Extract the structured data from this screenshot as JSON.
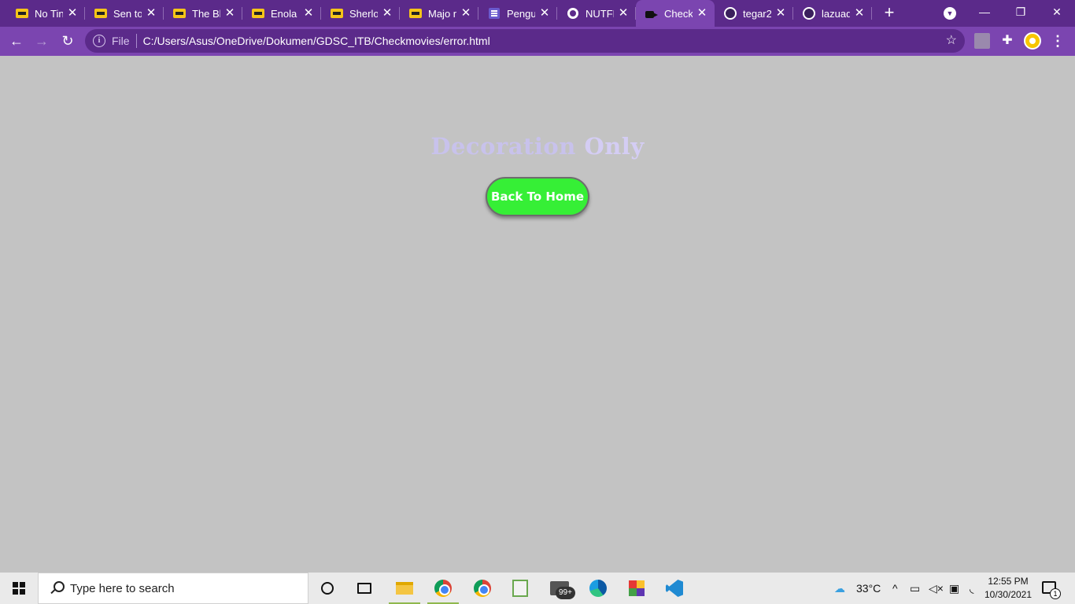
{
  "browser": {
    "tabs": [
      {
        "title": "No Tin",
        "icon": "imdb-icon"
      },
      {
        "title": "Sen to",
        "icon": "imdb-icon"
      },
      {
        "title": "The Bl",
        "icon": "imdb-icon"
      },
      {
        "title": "Enola H",
        "icon": "imdb-icon"
      },
      {
        "title": "Sherlo",
        "icon": "imdb-icon"
      },
      {
        "title": "Majo n",
        "icon": "imdb-icon"
      },
      {
        "title": "Pengu",
        "icon": "list-icon"
      },
      {
        "title": "NUTFL",
        "icon": "globe-icon"
      },
      {
        "title": "Check",
        "icon": "camera-icon",
        "active": true
      },
      {
        "title": "tegar2",
        "icon": "github-icon"
      },
      {
        "title": "lazuad",
        "icon": "github-icon"
      }
    ],
    "close_glyph": "✕",
    "new_tab_glyph": "+",
    "window_controls": {
      "minimize": "—",
      "maximize": "❐",
      "close": "✕"
    },
    "nav": {
      "back": "←",
      "forward": "→",
      "reload": "↻"
    },
    "omnibox": {
      "scheme_label": "File",
      "url": "C:/Users/Asus/OneDrive/Dokumen/GDSC_ITB/Checkmovies/error.html",
      "info_glyph": "i",
      "star_glyph": "☆"
    },
    "menu_glyph": "⋮",
    "puzzle_glyph": "✚",
    "tab_search_glyph": "▼"
  },
  "page": {
    "title_word1": "Decoration",
    "title_word2": "Only",
    "home_button_label": "Back To Home",
    "colors": {
      "background": "#c3c3c3",
      "title": "#c8c2ec",
      "button": "#36ef36"
    }
  },
  "taskbar": {
    "search_placeholder": "Type here to search",
    "mail_badge": "99+",
    "temperature": "33°C",
    "tray_chevron": "^",
    "time": "12:55 PM",
    "date": "10/30/2021",
    "notification_count": "1"
  }
}
